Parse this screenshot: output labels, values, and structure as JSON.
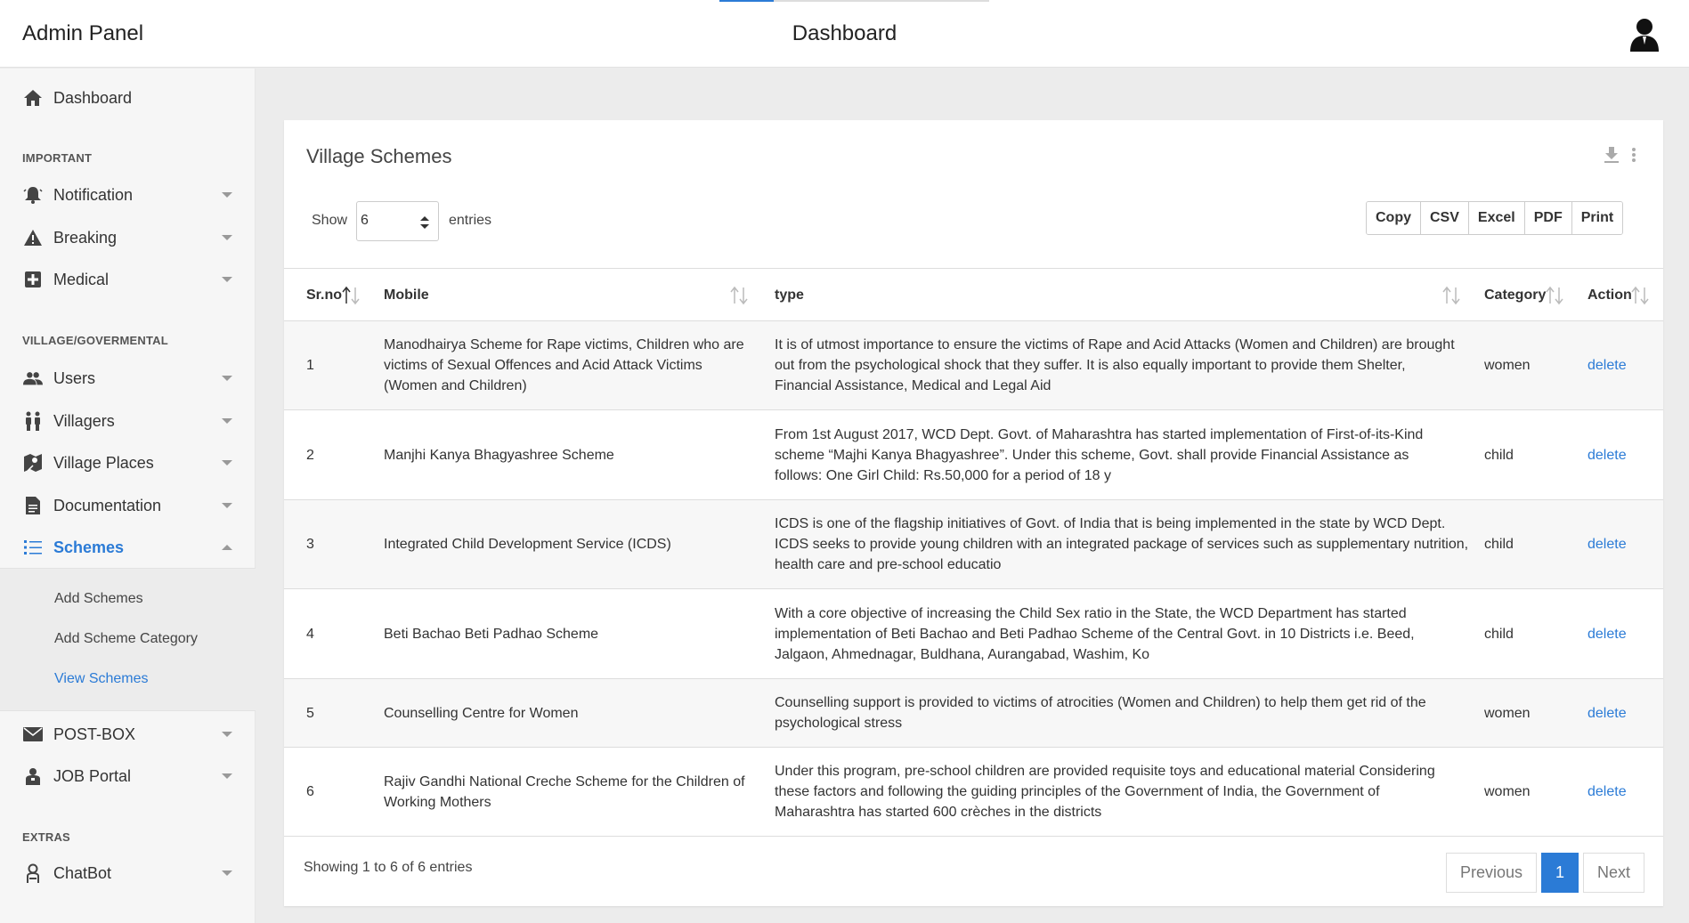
{
  "header": {
    "brand": "Admin Panel",
    "title": "Dashboard",
    "user_icon": "user-icon",
    "loading_progress": 0.2
  },
  "sidebar": {
    "dashboard": {
      "label": "Dashboard",
      "icon": "home-icon"
    },
    "sections": {
      "important": "IMPORTANT",
      "village": "VILLAGE/GOVERMENTAL",
      "extras": "EXTRAS"
    },
    "items": {
      "notification": "Notification",
      "breaking": "Breaking",
      "medical": "Medical",
      "users": "Users",
      "villagers": "Villagers",
      "village_places": "Village Places",
      "documentation": "Documentation",
      "schemes": "Schemes",
      "post_box": "POST-BOX",
      "job_portal": "JOB Portal",
      "chatbot": "ChatBot"
    },
    "scheme_sub": [
      "Add Schemes",
      "Add Scheme Category",
      "View Schemes"
    ],
    "active_item": "Schemes",
    "active_sub": "View Schemes"
  },
  "card": {
    "title": "Village Schemes",
    "show_label": "Show",
    "entries_value": "6",
    "entries_label": "entries",
    "export_buttons": [
      "Copy",
      "CSV",
      "Excel",
      "PDF",
      "Print"
    ],
    "columns": [
      "Sr.no",
      "Mobile",
      "type",
      "Category",
      "Action"
    ],
    "rows": [
      {
        "no": "1",
        "mobile": "Manodhairya Scheme for Rape victims, Children who are victims of Sexual Offences and Acid Attack Victims (Women and Children)",
        "type": "It is of utmost importance to ensure the victims of Rape and Acid Attacks (Women and Children) are brought out from the psychological shock that they suffer. It is also equally important to provide them Shelter, Financial Assistance, Medical and Legal Aid",
        "category": "women",
        "action": "delete"
      },
      {
        "no": "2",
        "mobile": "Manjhi Kanya Bhagyashree Scheme",
        "type": "From 1st August 2017, WCD Dept. Govt. of Maharashtra has started implementation of First-of-its-Kind scheme “Majhi Kanya Bhagyashree”. Under this scheme, Govt. shall provide Financial Assistance as follows: One Girl Child: Rs.50,000 for a period of 18 y",
        "category": "child",
        "action": "delete"
      },
      {
        "no": "3",
        "mobile": "Integrated Child Development Service (ICDS)",
        "type": "ICDS is one of the flagship initiatives of Govt. of India that is being implemented in the state by WCD Dept. ICDS seeks to provide young children with an integrated package of services such as supplementary nutrition, health care and pre-school educatio",
        "category": "child",
        "action": "delete"
      },
      {
        "no": "4",
        "mobile": "Beti Bachao Beti Padhao Scheme",
        "type": "With a core objective of increasing the Child Sex ratio in the State, the WCD Department has started implementation of Beti Bachao and Beti Padhao Scheme of the Central Govt. in 10 Districts i.e. Beed, Jalgaon, Ahmednagar, Buldhana, Aurangabad, Washim, Ko",
        "category": "child",
        "action": "delete"
      },
      {
        "no": "5",
        "mobile": "Counselling Centre for Women",
        "type": "Counselling support is provided to victims of atrocities (Women and Children) to help them get rid of the psychological stress",
        "category": "women",
        "action": "delete"
      },
      {
        "no": "6",
        "mobile": "Rajiv Gandhi National Creche Scheme for the Children of Working Mothers",
        "type": "Under this program, pre-school children are provided requisite toys and educational material Considering these factors and following the guiding principles of the Government of India, the Government of Maharashtra has started 600 crèches in the districts",
        "category": "women",
        "action": "delete"
      }
    ],
    "info": "Showing 1 to 6 of 6 entries",
    "pager": {
      "previous": "Previous",
      "current": "1",
      "next": "Next"
    },
    "tools": [
      "download-icon",
      "more-vertical-icon"
    ]
  },
  "colors": {
    "accent": "#2b7bd6",
    "active_text": "#2b7bd6",
    "link": "#2b7bd6"
  }
}
